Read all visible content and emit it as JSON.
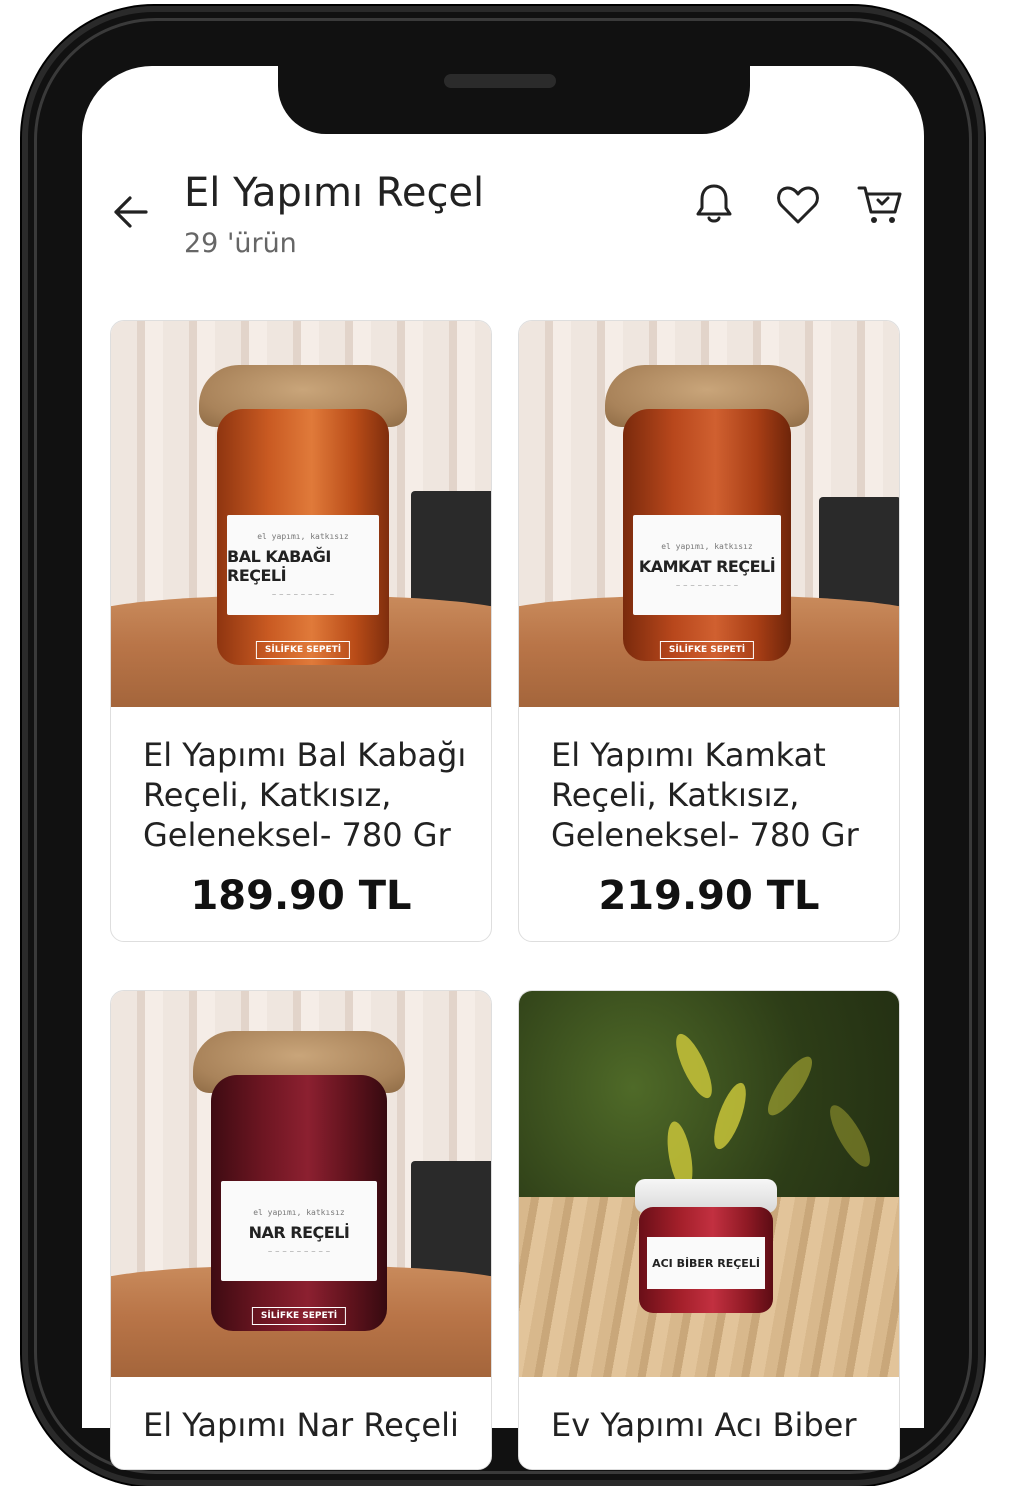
{
  "header": {
    "title": "El Yapımı Reçel",
    "subtitle": "29 'ürün"
  },
  "products": [
    {
      "name": "El Yapımı Bal Kabağı Reçeli, Katkısız, Geleneksel- 780 Gr",
      "price": "189.90 TL",
      "jar_label": "BAL KABAĞI REÇELİ",
      "jar_color": "#c2561f"
    },
    {
      "name": "El Yapımı Kamkat Reçeli, Katkısız, Geleneksel- 780 Gr",
      "price": "219.90 TL",
      "jar_label": "KAMKAT REÇELİ",
      "jar_color": "#b9471e"
    },
    {
      "name": "El Yapımı Nar Reçeli",
      "price": "",
      "jar_label": "NAR REÇELİ",
      "jar_color": "#6e1622"
    },
    {
      "name": "Ev Yapımı Acı Biber",
      "price": "",
      "jar_label": "ACI BİBER REÇELİ",
      "jar_color": "#a31f2a"
    }
  ],
  "jar_small_text": "el yapımı, katkısız",
  "jar_brand": "SİLİFKE SEPETİ",
  "icons": {
    "back": "arrow-left-icon",
    "bell": "bell-icon",
    "favorite": "heart-icon",
    "cart": "cart-icon"
  }
}
